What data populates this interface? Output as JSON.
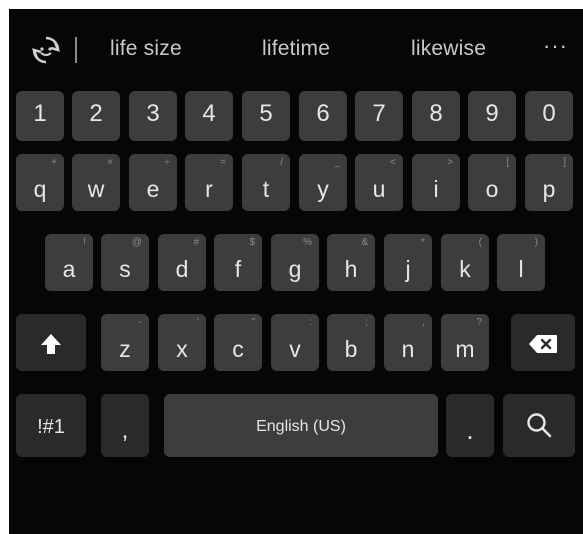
{
  "suggestions": {
    "items": [
      "life size",
      "lifetime",
      "likewise"
    ],
    "more": "···"
  },
  "rows": {
    "numbers": [
      "1",
      "2",
      "3",
      "4",
      "5",
      "6",
      "7",
      "8",
      "9",
      "0"
    ],
    "row1": [
      {
        "key": "q",
        "hint": "+"
      },
      {
        "key": "w",
        "hint": "×"
      },
      {
        "key": "e",
        "hint": "÷"
      },
      {
        "key": "r",
        "hint": "="
      },
      {
        "key": "t",
        "hint": "/"
      },
      {
        "key": "y",
        "hint": "_"
      },
      {
        "key": "u",
        "hint": "<"
      },
      {
        "key": "i",
        "hint": ">"
      },
      {
        "key": "o",
        "hint": "["
      },
      {
        "key": "p",
        "hint": "]"
      }
    ],
    "row2": [
      {
        "key": "a",
        "hint": "!"
      },
      {
        "key": "s",
        "hint": "@"
      },
      {
        "key": "d",
        "hint": "#"
      },
      {
        "key": "f",
        "hint": "$"
      },
      {
        "key": "g",
        "hint": "%"
      },
      {
        "key": "h",
        "hint": "&"
      },
      {
        "key": "j",
        "hint": "*"
      },
      {
        "key": "k",
        "hint": "("
      },
      {
        "key": "l",
        "hint": ")"
      }
    ],
    "row3": [
      {
        "key": "z",
        "hint": "-"
      },
      {
        "key": "x",
        "hint": "'"
      },
      {
        "key": "c",
        "hint": "\""
      },
      {
        "key": "v",
        "hint": ":"
      },
      {
        "key": "b",
        "hint": ";"
      },
      {
        "key": "n",
        "hint": ","
      },
      {
        "key": "m",
        "hint": "?"
      }
    ]
  },
  "bottom": {
    "symbols_label": "!#1",
    "comma_label": ",",
    "space_label": "English (US)",
    "period_label": "."
  },
  "icons": {
    "refresh": "refresh-icon",
    "shift": "shift-arrow-icon",
    "backspace": "backspace-icon",
    "search": "search-icon"
  },
  "colors": {
    "background": "#060606",
    "key": "#3d3d3d",
    "key_function": "#2a2a2a",
    "key_text": "#e6e6e6",
    "suggestion_text": "#c9c9c9"
  }
}
